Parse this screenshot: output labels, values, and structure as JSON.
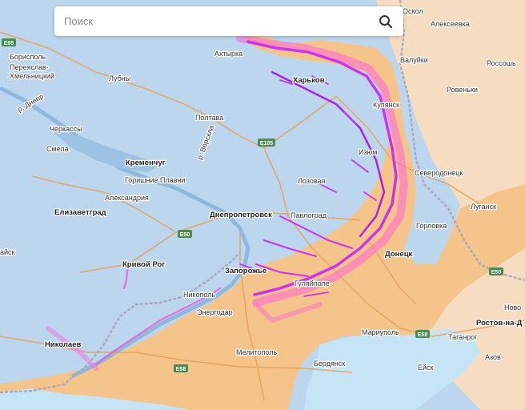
{
  "search": {
    "placeholder": "Поиск"
  },
  "colors": {
    "ukraine_controlled": "#bcd6ee",
    "occupied": "#f5c48a",
    "russia": "#f6dcc0",
    "sea": "#c5e5f7",
    "frontline": "#dd33dd",
    "roads": "#e6a15a",
    "border": "#a0a0b0"
  },
  "cities": [
    {
      "id": "oskol",
      "name": "Оскол"
    },
    {
      "id": "alekseevka",
      "name": "Алексеевка"
    },
    {
      "id": "borispol",
      "name": "Борисполь"
    },
    {
      "id": "pereyaslav",
      "name": "Переяслав-Хмельницкий"
    },
    {
      "id": "akhtyrka",
      "name": "Ахтырка"
    },
    {
      "id": "valuyki",
      "name": "Валуйки"
    },
    {
      "id": "rossosh",
      "name": "Россошь"
    },
    {
      "id": "lubny",
      "name": "Лубны"
    },
    {
      "id": "kharkov",
      "name": "Харьков"
    },
    {
      "id": "rovenki",
      "name": "Ровеньки"
    },
    {
      "id": "kupyansk",
      "name": "Купянск"
    },
    {
      "id": "cherkassy",
      "name": "Черкассы"
    },
    {
      "id": "poltava",
      "name": "Полтава"
    },
    {
      "id": "smela",
      "name": "Смела"
    },
    {
      "id": "izyum",
      "name": "Изюм"
    },
    {
      "id": "kremenchug",
      "name": "Кременчуг"
    },
    {
      "id": "gorishnie",
      "name": "Горишние Плавни"
    },
    {
      "id": "severodonetsk",
      "name": "Северодонецк"
    },
    {
      "id": "lozovaya",
      "name": "Лозовая"
    },
    {
      "id": "aleksandriya",
      "name": "Александрия"
    },
    {
      "id": "lugansk",
      "name": "Луганск"
    },
    {
      "id": "elisavetgrad",
      "name": "Елизаветград"
    },
    {
      "id": "dnepropetrovsk",
      "name": "Днепропетровск"
    },
    {
      "id": "pavlograd",
      "name": "Павлоград"
    },
    {
      "id": "gorlovka",
      "name": "Горловка"
    },
    {
      "id": "aik",
      "name": "айск"
    },
    {
      "id": "donetsk",
      "name": "Донецк"
    },
    {
      "id": "krivoy_rog",
      "name": "Кривой Рог"
    },
    {
      "id": "zaporozhye",
      "name": "Запорожье"
    },
    {
      "id": "gulyaypole",
      "name": "Гуляйполе"
    },
    {
      "id": "nikopol",
      "name": "Никополь"
    },
    {
      "id": "energodar",
      "name": "Энергодар"
    },
    {
      "id": "novo",
      "name": "Ново"
    },
    {
      "id": "rostov",
      "name": "Ростов-на-Д"
    },
    {
      "id": "nikolaev",
      "name": "Николаев"
    },
    {
      "id": "mariupol",
      "name": "Мариуполь"
    },
    {
      "id": "taganrog",
      "name": "Таганрог"
    },
    {
      "id": "melitopol",
      "name": "Мелитополь"
    },
    {
      "id": "azov",
      "name": "Азов"
    },
    {
      "id": "berdyansk",
      "name": "Бердянск"
    },
    {
      "id": "eysk",
      "name": "Ейск"
    },
    {
      "id": "dnepr_river",
      "name": "р. Днепр"
    },
    {
      "id": "vorskla_river",
      "name": "р. Ворскла"
    }
  ],
  "roads": [
    {
      "id": "e95",
      "label": "E95"
    },
    {
      "id": "e105",
      "label": "E105"
    },
    {
      "id": "e50a",
      "label": "E50"
    },
    {
      "id": "e50b",
      "label": "E50"
    },
    {
      "id": "e58a",
      "label": "E58"
    },
    {
      "id": "e58b",
      "label": "E58"
    }
  ]
}
